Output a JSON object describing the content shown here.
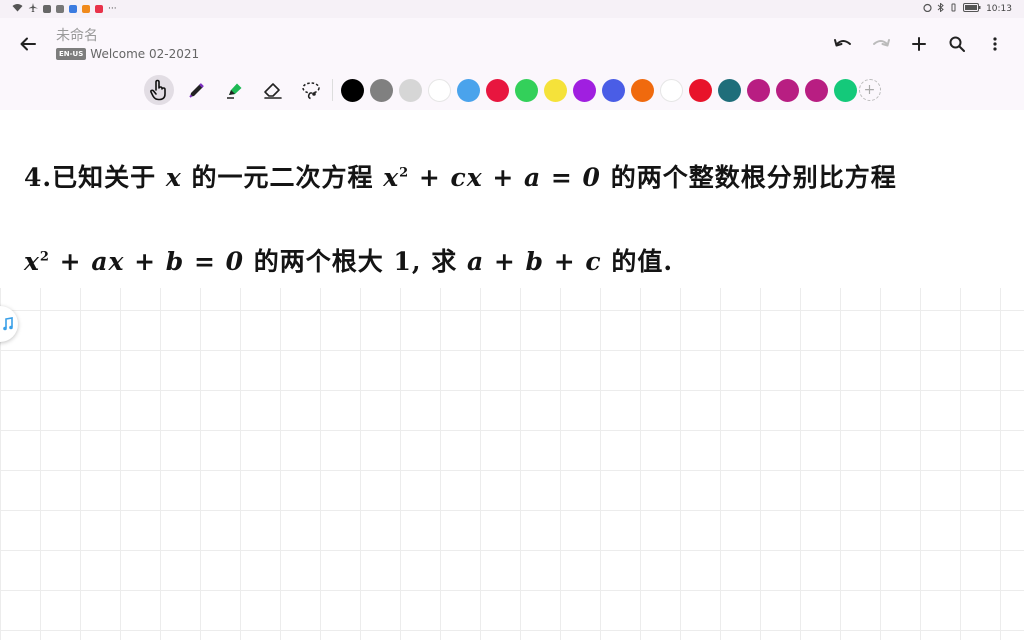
{
  "statusbar": {
    "time": "10:13",
    "battery": "95"
  },
  "header": {
    "title": "未命名",
    "lang_badge": "EN-US",
    "notebook": "Welcome 02-2021"
  },
  "toolbar": {
    "tools": [
      "hand-icon",
      "pen-icon",
      "highlighter-icon",
      "eraser-icon",
      "lasso-icon"
    ],
    "colors": [
      "#000000",
      "#808080",
      "#d6d6d6",
      "#ffffff",
      "#4aa3ec",
      "#e8163f",
      "#33d05a",
      "#f5e23a",
      "#a01fe0",
      "#4a5de6",
      "#f06a0e",
      "#ffffff",
      "#e8132a",
      "#1f6e7a",
      "#b81e82",
      "#b81e82",
      "#b81e82",
      "#14c97a"
    ],
    "add_label": "+"
  },
  "question": {
    "l1_num": "4.",
    "l1_a": "已知关于",
    "l1_var": "x",
    "l1_b": "的一元二次方程",
    "l1_eq_x": "x",
    "l1_exp": "2",
    "l1_eq_rest": "+ cx + a = 0",
    "l1_c": "的两个整数根分别比方程",
    "l2_eq_x": "x",
    "l2_exp": "2",
    "l2_eq_rest": "+ ax + b = 0",
    "l2_a": "的两个根大 1, 求",
    "l2_expr": "a + b + c",
    "l2_b": "的值."
  }
}
